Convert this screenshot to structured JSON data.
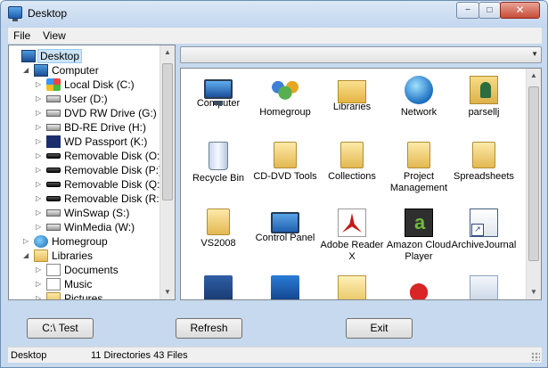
{
  "window": {
    "title": "Desktop",
    "minimize_label": "−",
    "maximize_label": "□",
    "close_label": "✕"
  },
  "menu": {
    "file": "File",
    "view": "View"
  },
  "tree": {
    "items": [
      {
        "label": "Desktop",
        "icon": "monitor-icon",
        "level": 0,
        "selected": true,
        "expander": ""
      },
      {
        "label": "Computer",
        "icon": "monitor-icon",
        "level": 1,
        "expander": "◢"
      },
      {
        "label": "Local Disk (C:)",
        "icon": "windows-drive-icon",
        "level": 2,
        "expander": "▷"
      },
      {
        "label": "User (D:)",
        "icon": "drive-icon",
        "level": 2,
        "expander": "▷"
      },
      {
        "label": "DVD RW Drive (G:)",
        "icon": "drive-icon",
        "level": 2,
        "expander": "▷"
      },
      {
        "label": "BD-RE Drive (H:)",
        "icon": "drive-icon",
        "level": 2,
        "expander": "▷"
      },
      {
        "label": "WD Passport (K:)",
        "icon": "wd-icon",
        "level": 2,
        "expander": "▷"
      },
      {
        "label": "Removable Disk (O:)",
        "icon": "removable-disk-icon",
        "level": 2,
        "expander": "▷"
      },
      {
        "label": "Removable Disk (P:)",
        "icon": "removable-disk-icon",
        "level": 2,
        "expander": "▷"
      },
      {
        "label": "Removable Disk (Q:)",
        "icon": "removable-disk-icon",
        "level": 2,
        "expander": "▷"
      },
      {
        "label": "Removable Disk (R:)",
        "icon": "removable-disk-icon",
        "level": 2,
        "expander": "▷"
      },
      {
        "label": "WinSwap (S:)",
        "icon": "drive-icon",
        "level": 2,
        "expander": "▷"
      },
      {
        "label": "WinMedia (W:)",
        "icon": "drive-icon",
        "level": 2,
        "expander": "▷"
      },
      {
        "label": "Homegroup",
        "icon": "homegroup-icon",
        "level": 1,
        "expander": "▷"
      },
      {
        "label": "Libraries",
        "icon": "folder-icon",
        "level": 1,
        "expander": "◢"
      },
      {
        "label": "Documents",
        "icon": "document-icon",
        "level": 2,
        "expander": "▷"
      },
      {
        "label": "Music",
        "icon": "music-icon",
        "level": 2,
        "expander": "▷"
      },
      {
        "label": "Pictures",
        "icon": "folder-icon",
        "level": 2,
        "expander": "▷"
      }
    ]
  },
  "path_dropdown": {
    "value": ""
  },
  "files": {
    "items": [
      {
        "label": "Computer",
        "icon": "computer-icon"
      },
      {
        "label": "Homegroup",
        "icon": "homegroup-icon"
      },
      {
        "label": "Libraries",
        "icon": "libraries-icon"
      },
      {
        "label": "Network",
        "icon": "network-icon"
      },
      {
        "label": "parsellj",
        "icon": "user-folder-icon"
      },
      {
        "label": "Recycle Bin",
        "icon": "recycle-bin-icon"
      },
      {
        "label": "CD-DVD Tools",
        "icon": "folder-icon"
      },
      {
        "label": "Collections",
        "icon": "folder-icon"
      },
      {
        "label": "Project Management",
        "icon": "folder-icon"
      },
      {
        "label": "Spreadsheets",
        "icon": "folder-icon"
      },
      {
        "label": "VS2008",
        "icon": "folder-icon"
      },
      {
        "label": "Control Panel",
        "icon": "control-panel-icon"
      },
      {
        "label": "Adobe Reader X",
        "icon": "adobe-reader-icon"
      },
      {
        "label": "Amazon Cloud Player",
        "icon": "amazon-cloud-player-icon"
      },
      {
        "label": "ArchiveJournal",
        "icon": "shortcut-icon"
      },
      {
        "label": "",
        "icon": "shortcut-icon"
      },
      {
        "label": "",
        "icon": "shortcut-icon"
      },
      {
        "label": "",
        "icon": "mail-icon"
      },
      {
        "label": "",
        "icon": "shortcut-icon"
      },
      {
        "label": "",
        "icon": "shortcut-icon"
      }
    ]
  },
  "buttons": {
    "test": "C:\\ Test",
    "refresh": "Refresh",
    "exit": "Exit"
  },
  "status": {
    "location": "Desktop",
    "summary": "11 Directories 43 Files"
  },
  "colors": {
    "selection": "#cce4f7",
    "window_frame": "#c6d9ee",
    "close_button": "#c74c36"
  }
}
